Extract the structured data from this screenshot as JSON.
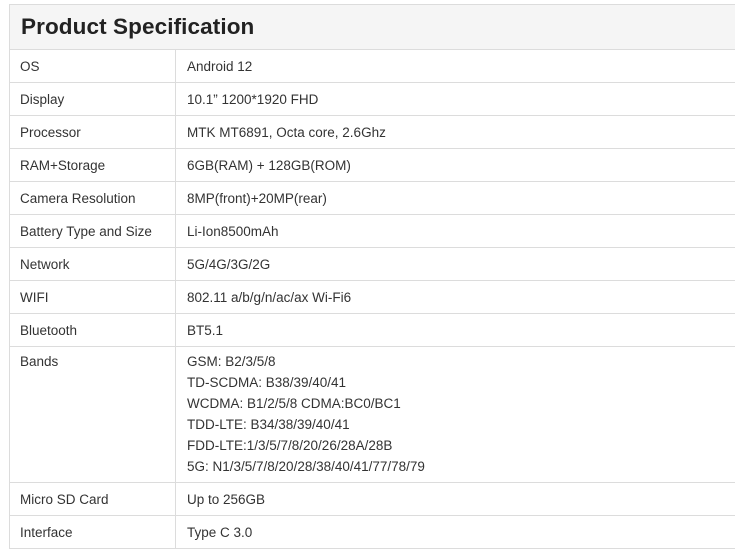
{
  "title": "Product Specification",
  "rows": [
    {
      "label": "OS",
      "value": "Android 12"
    },
    {
      "label": "Display",
      "value": "10.1” 1200*1920 FHD"
    },
    {
      "label": "Processor",
      "value": "MTK MT6891, Octa core, 2.6Ghz"
    },
    {
      "label": "RAM+Storage",
      "value": "6GB(RAM) + 128GB(ROM)"
    },
    {
      "label": "Camera Resolution",
      "value": "8MP(front)+20MP(rear)"
    },
    {
      "label": "Battery Type and Size",
      "value": "Li-Ion8500mAh"
    },
    {
      "label": "Network",
      "value": "5G/4G/3G/2G"
    },
    {
      "label": "WIFI",
      "value": "802.11 a/b/g/n/ac/ax Wi-Fi6"
    },
    {
      "label": "Bluetooth",
      "value": "BT5.1"
    }
  ],
  "bands": {
    "label": "Bands",
    "lines": [
      "GSM: B2/3/5/8",
      "TD-SCDMA: B38/39/40/41",
      "WCDMA: B1/2/5/8 CDMA:BC0/BC1",
      "TDD-LTE: B34/38/39/40/41",
      "FDD-LTE:1/3/5/7/8/20/26/28A/28B",
      "5G: N1/3/5/7/8/20/28/38/40/41/77/78/79"
    ]
  },
  "rows_after": [
    {
      "label": "Micro SD Card",
      "value": "Up to 256GB"
    },
    {
      "label": "Interface",
      "value": "Type C 3.0"
    }
  ]
}
